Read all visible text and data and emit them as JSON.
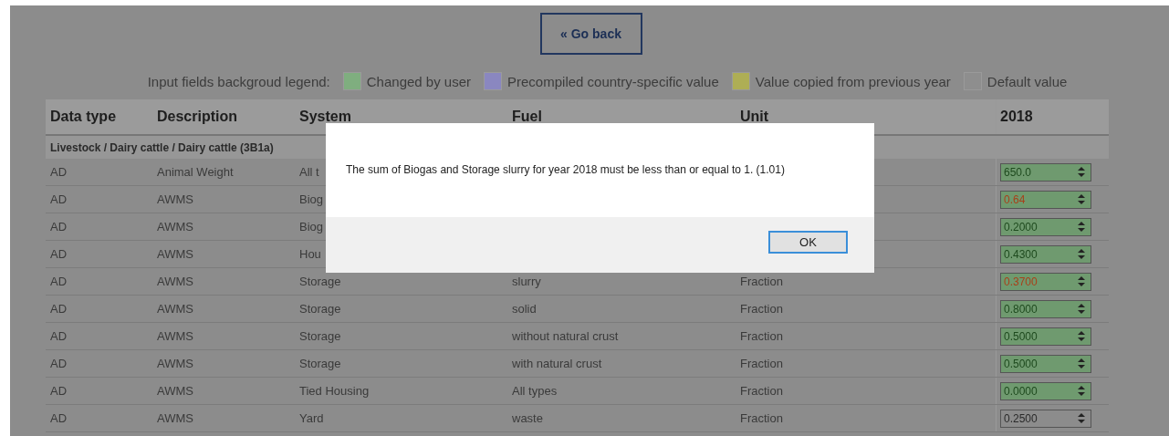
{
  "go_back_button": {
    "label": "« Go back"
  },
  "legend": {
    "label": "Input fields backgroud legend:",
    "items": [
      {
        "label": "Changed by user",
        "color": "#7fae7f"
      },
      {
        "label": "Precompiled country-specific value",
        "color": "#8a87c0"
      },
      {
        "label": "Value copied from previous year",
        "color": "#aeae55"
      },
      {
        "label": "Default value",
        "color": "#8e8e8e"
      }
    ]
  },
  "table": {
    "columns": [
      "Data type",
      "Description",
      "System",
      "Fuel",
      "Unit",
      "2018"
    ],
    "section": "Livestock / Dairy cattle / Dairy cattle (3B1a)",
    "rows": [
      {
        "data_type": "AD",
        "description": "Animal Weight",
        "system": "All t",
        "value": "650.0",
        "kind": "user",
        "error": false
      },
      {
        "data_type": "AD",
        "description": "AWMS",
        "system": "Biog",
        "value": "0.64",
        "kind": "user",
        "error": true
      },
      {
        "data_type": "AD",
        "description": "AWMS",
        "system": "Biog",
        "value": "0.2000",
        "kind": "user",
        "error": false
      },
      {
        "data_type": "AD",
        "description": "AWMS",
        "system": "Hou",
        "value": "0.4300",
        "kind": "user",
        "error": false
      },
      {
        "data_type": "AD",
        "description": "AWMS",
        "system": "Storage",
        "fuel": "slurry",
        "unit": "Fraction",
        "value": "0.3700",
        "kind": "user",
        "error": true
      },
      {
        "data_type": "AD",
        "description": "AWMS",
        "system": "Storage",
        "fuel": "solid",
        "unit": "Fraction",
        "value": "0.8000",
        "kind": "user",
        "error": false
      },
      {
        "data_type": "AD",
        "description": "AWMS",
        "system": "Storage",
        "fuel": "without natural crust",
        "unit": "Fraction",
        "value": "0.5000",
        "kind": "user",
        "error": false
      },
      {
        "data_type": "AD",
        "description": "AWMS",
        "system": "Storage",
        "fuel": "with natural crust",
        "unit": "Fraction",
        "value": "0.5000",
        "kind": "user",
        "error": false
      },
      {
        "data_type": "AD",
        "description": "AWMS",
        "system": "Tied Housing",
        "fuel": "All types",
        "unit": "Fraction",
        "value": "0.0000",
        "kind": "user",
        "error": false
      },
      {
        "data_type": "AD",
        "description": "AWMS",
        "system": "Yard",
        "fuel": "waste",
        "unit": "Fraction",
        "value": "0.2500",
        "kind": "default",
        "error": false
      }
    ]
  },
  "dialog": {
    "message": "The sum of Biogas and Storage slurry for year 2018 must be less than or equal to 1. (1.01)",
    "ok_button": "OK"
  }
}
